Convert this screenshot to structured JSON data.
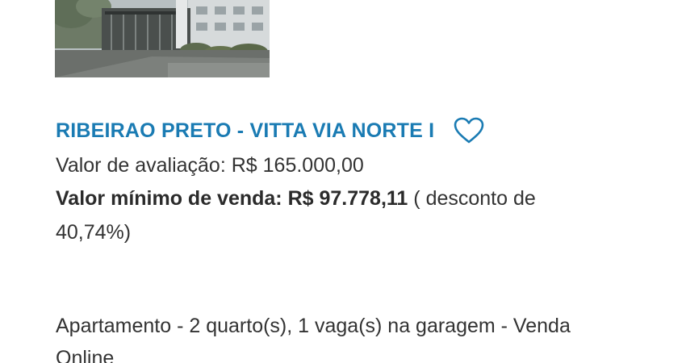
{
  "listing": {
    "title": "RIBEIRAO PRETO - VITTA VIA NORTE I",
    "valuation_label": "Valor de avaliação:",
    "valuation_value": "R$ 165.000,00",
    "min_sale_label": "Valor mínimo de venda:",
    "min_sale_value": "R$ 97.778,11",
    "discount_prefix": "( desconto de",
    "discount_value": "40,74%)",
    "description_line1": "Apartamento - 2 quarto(s), 1 vaga(s) na garagem - Venda",
    "description_line2": "Online"
  },
  "icons": {
    "favorite": "heart-outline-icon"
  },
  "colors": {
    "title": "#1a7bb3",
    "text": "#333333",
    "heart": "#1a7bb3"
  }
}
